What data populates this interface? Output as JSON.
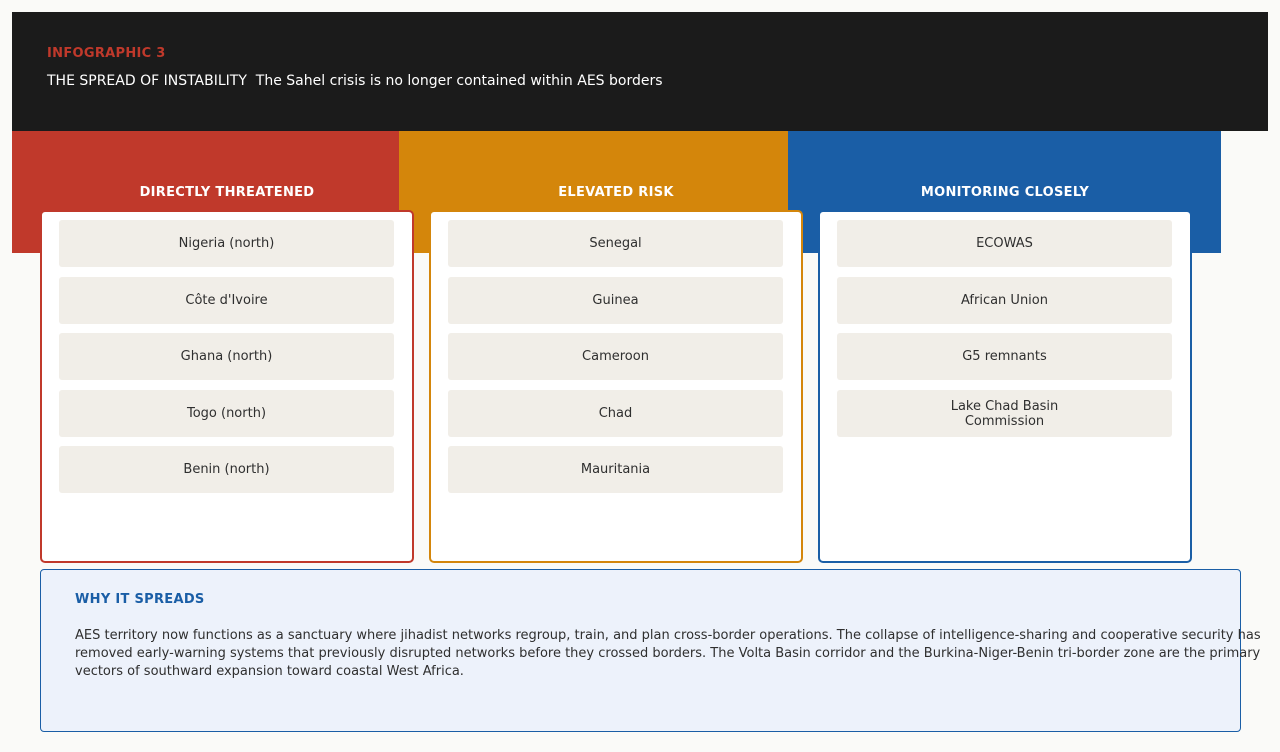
{
  "header": {
    "kicker": "INFOGRAPHIC 3",
    "title": "THE SPREAD OF INSTABILITY  The Sahel crisis is no longer contained within AES borders"
  },
  "colors": {
    "background": "#fafaf8",
    "header_bg": "#1b1b1b",
    "kicker": "#c0392b",
    "threatened": "#c0392b",
    "elevated": "#d4860b",
    "monitoring": "#1a5ea6",
    "item_bg": "#f1eee8",
    "note_bg": "#edf2fb",
    "text": "#2f2f2f"
  },
  "columns": [
    {
      "title": "DIRECTLY THREATENED",
      "items": [
        "Nigeria (north)",
        "Côte d'Ivoire",
        "Ghana (north)",
        "Togo (north)",
        "Benin (north)"
      ]
    },
    {
      "title": "ELEVATED RISK",
      "items": [
        "Senegal",
        "Guinea",
        "Cameroon",
        "Chad",
        "Mauritania"
      ]
    },
    {
      "title": "MONITORING CLOSELY",
      "items": [
        "ECOWAS",
        "African Union",
        "G5 remnants",
        "Lake Chad Basin Commission"
      ]
    }
  ],
  "note": {
    "title": "WHY IT SPREADS",
    "body": "AES territory now functions as a sanctuary where jihadist networks regroup, train, and plan cross-border operations. The collapse of intelligence-sharing and cooperative security has removed early-warning systems that previously disrupted networks before they crossed borders. The Volta Basin corridor and the Burkina-Niger-Benin tri-border zone are the primary vectors of southward expansion toward coastal West Africa."
  }
}
